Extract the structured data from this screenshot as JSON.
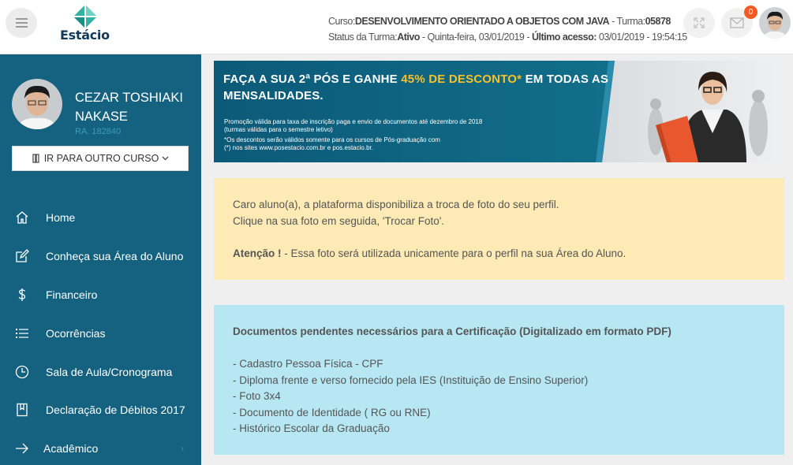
{
  "header": {
    "logo_text": "Estácio",
    "course_label": "Curso:",
    "course_name": "DESENVOLVIMENTO ORIENTADO A OBJETOS COM JAVA",
    "class_label": " - Turma:",
    "class_code": "05878",
    "status_label": "Status da Turma:",
    "status_value": "Ativo",
    "status_date": " - Quinta-feira, 03/01/2019 - ",
    "last_access_label": "Último acesso:",
    "last_access_value": " 03/01/2019 - 19:54:15",
    "mail_count": "0",
    "icons": [
      "menu-icon",
      "expand-icon",
      "mail-icon"
    ]
  },
  "profile": {
    "name": "CEZAR TOSHIAKI NAKASE",
    "ra": "RA. 182840",
    "course_button": "IR PARA OUTRO CURSO"
  },
  "nav": [
    {
      "label": "Home",
      "icon": "home-icon"
    },
    {
      "label": "Conheça sua Área do Aluno",
      "icon": "edit-icon"
    },
    {
      "label": "Financeiro",
      "icon": "dollar-icon"
    },
    {
      "label": "Ocorrências",
      "icon": "list-icon"
    },
    {
      "label": "Sala de Aula/Cronograma",
      "icon": "clock-icon"
    },
    {
      "label": "Declaração de Débitos 2017",
      "icon": "bookmark-icon"
    },
    {
      "label": "Acadêmico",
      "icon": "arrow-right-icon"
    }
  ],
  "banner": {
    "title_1": "FAÇA A SUA 2ª PÓS E GANHE ",
    "title_highlight": "45% DE DESCONTO*",
    "title_2": " EM TODAS AS MENSALIDADES.",
    "line_1": "Promoção válida para taxa de inscrição paga e envio de documentos até dezembro de 2018",
    "line_2": "(turmas válidas para o semestre letivo)",
    "line_3": "*Os descontos serão válidos somente para os cursos de Pós-graduação com",
    "line_4": "(*) nos sites www.posestacio.com.br e pos.estacio.br.",
    "colors": {
      "bg": "#0e5f7a",
      "highlight": "#f6c22c"
    }
  },
  "photo_alert": {
    "line_1": "Caro aluno(a), a plataforma disponibiliza a troca de foto do seu perfil.",
    "line_2": "Clique na sua foto em seguida, 'Trocar Foto'.",
    "attention_label": "Atenção !",
    "attention_text": " - Essa foto será utilizada unicamente para o perfil na sua Área do Aluno."
  },
  "documents_alert": {
    "title": "Documentos pendentes necessários para a Certificação (Digitalizado em formato PDF)",
    "items": [
      "- Cadastro Pessoa Física - CPF",
      "- Diploma frente e verso fornecido pela IES (Instituição de Ensino Superior)",
      "- Foto 3x4",
      "- Documento de Identidade ( RG ou RNE)",
      "- Histórico Escolar da Graduação"
    ]
  },
  "colors": {
    "sidebar": "#14627f",
    "alert_yellow": "#fdeab4",
    "alert_blue": "#b6e7f2",
    "badge": "#f15a22"
  }
}
